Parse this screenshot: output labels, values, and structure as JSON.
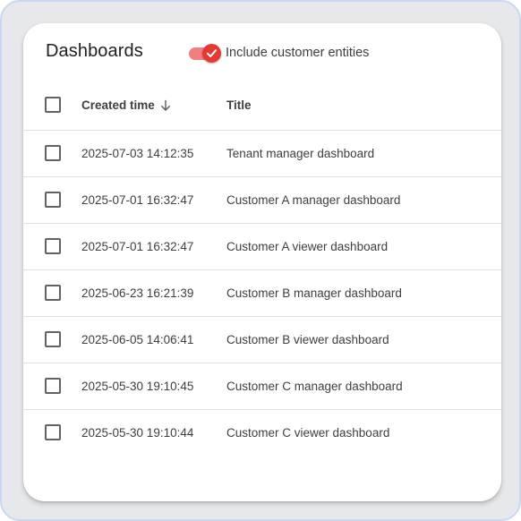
{
  "header": {
    "title": "Dashboards",
    "include_customer_entities_label": "Include customer entities",
    "include_customer_entities_checked": true
  },
  "table": {
    "columns": {
      "created_time": "Created time",
      "title": "Title"
    },
    "sort": {
      "column": "created_time",
      "direction": "descending",
      "icon": "arrow-down-icon"
    },
    "rows": [
      {
        "created_time": "2025-07-03 14:12:35",
        "title": "Tenant manager dashboard"
      },
      {
        "created_time": "2025-07-01 16:32:47",
        "title": "Customer A manager dashboard"
      },
      {
        "created_time": "2025-07-01 16:32:47",
        "title": "Customer A viewer dashboard"
      },
      {
        "created_time": "2025-06-23 16:21:39",
        "title": "Customer B manager dashboard"
      },
      {
        "created_time": "2025-06-05 14:06:41",
        "title": "Customer B viewer dashboard"
      },
      {
        "created_time": "2025-05-30 19:10:45",
        "title": "Customer C manager dashboard"
      },
      {
        "created_time": "2025-05-30 19:10:44",
        "title": "Customer C viewer dashboard"
      }
    ]
  },
  "colors": {
    "accent": "#e53935",
    "accent_track": "#f08080",
    "frame_border": "#c9d8f0",
    "frame_background": "#e6e8ec"
  }
}
